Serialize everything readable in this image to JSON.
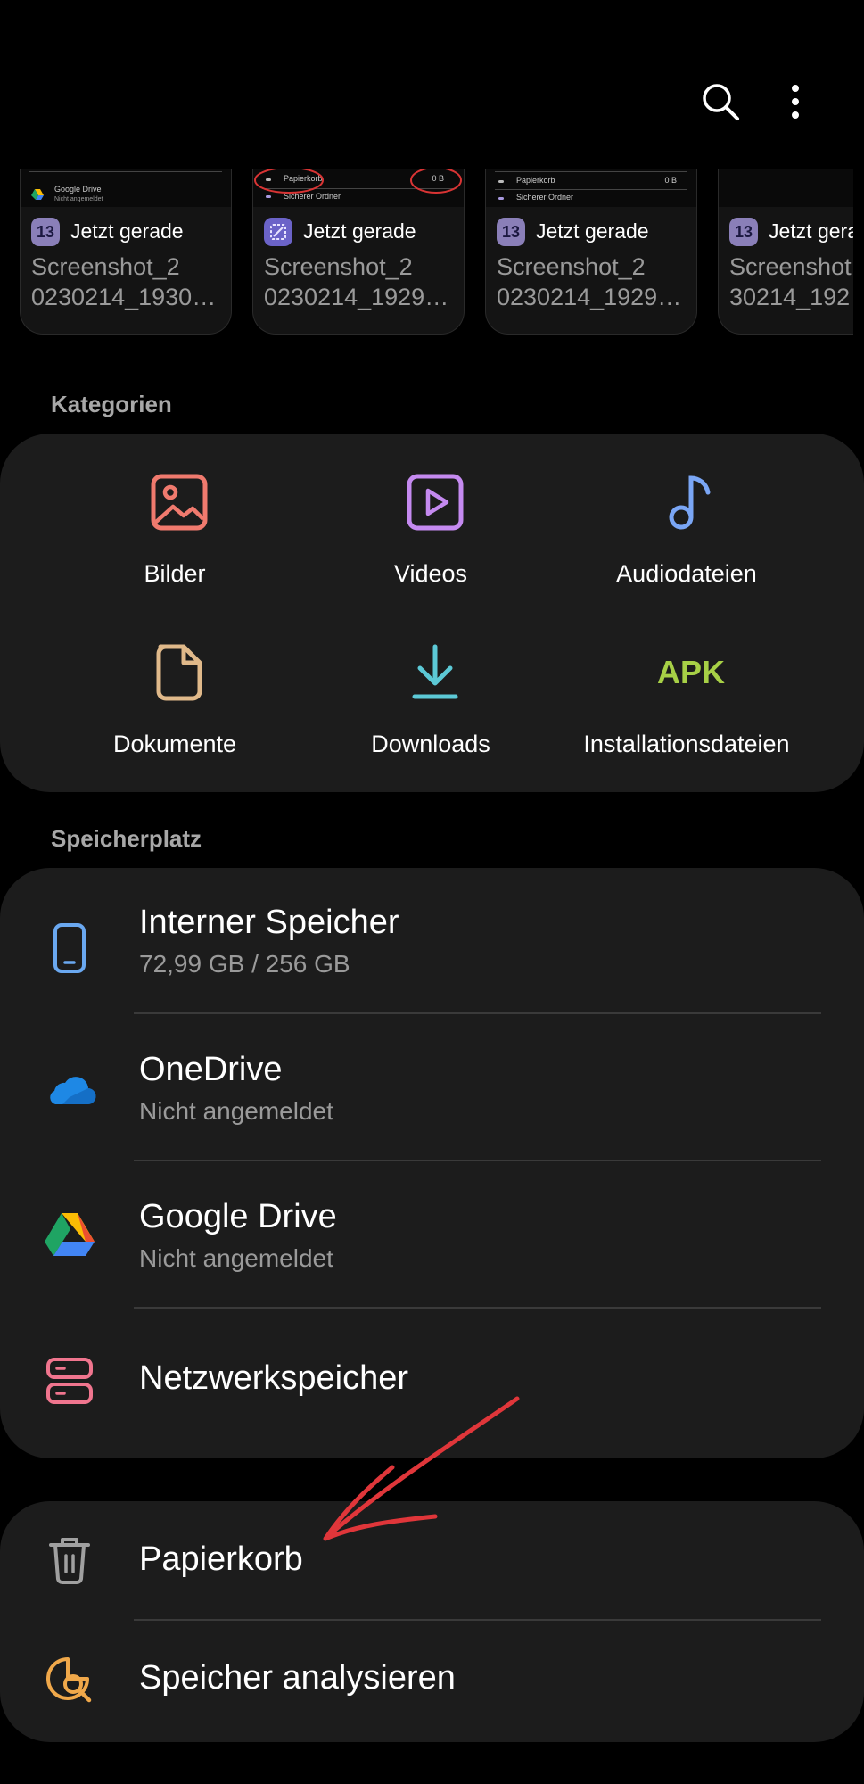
{
  "recents": [
    {
      "time": "Jetzt gerade",
      "name_line1": "Screenshot_2",
      "name_line2": "0230214_1930…",
      "icon": "13",
      "thumb": {
        "line1": "Google Drive",
        "line2": "Nicht angemeldet"
      }
    },
    {
      "time": "Jetzt gerade",
      "name_line1": "Screenshot_2",
      "name_line2": "0230214_1929…",
      "icon": "edit-icon",
      "thumb": {
        "line1": "Papierkorb",
        "size": "0 B",
        "line2": "Sicherer Ordner"
      }
    },
    {
      "time": "Jetzt gerade",
      "name_line1": "Screenshot_2",
      "name_line2": "0230214_1929…",
      "icon": "13",
      "thumb": {
        "line1": "Papierkorb",
        "size": "0 B",
        "line2": "Sicherer Ordner"
      }
    },
    {
      "time": "Jetzt gera",
      "name_line1": "Screenshot",
      "name_line2": "30214_192",
      "icon": "13",
      "thumb": {
        "line1": "",
        "line2": ""
      }
    }
  ],
  "categories_title": "Kategorien",
  "categories": [
    {
      "label": "Bilder",
      "icon": "image-icon",
      "color": "#f07a6e"
    },
    {
      "label": "Videos",
      "icon": "video-icon",
      "color": "#c58af0"
    },
    {
      "label": "Audiodateien",
      "icon": "music-icon",
      "color": "#7aa6f5"
    },
    {
      "label": "Dokumente",
      "icon": "document-icon",
      "color": "#e0b98a"
    },
    {
      "label": "Downloads",
      "icon": "download-icon",
      "color": "#5cc9d6"
    },
    {
      "label": "Installationsdateien",
      "icon": "apk-icon",
      "icon_text": "APK",
      "color": "#a7d046"
    }
  ],
  "storage_title": "Speicherplatz",
  "storage": [
    {
      "title": "Interner Speicher",
      "subtitle": "72,99 GB / 256 GB",
      "icon": "phone-icon",
      "color": "#6aa8f0"
    },
    {
      "title": "OneDrive",
      "subtitle": "Nicht angemeldet",
      "icon": "onedrive-icon",
      "color": "#1e88e5"
    },
    {
      "title": "Google Drive",
      "subtitle": "Nicht angemeldet",
      "icon": "google-drive-icon"
    },
    {
      "title": "Netzwerkspeicher",
      "subtitle": "",
      "icon": "server-icon",
      "color": "#f0758e"
    }
  ],
  "tools": [
    {
      "title": "Papierkorb",
      "icon": "trash-icon",
      "color": "#a0a0a0"
    },
    {
      "title": "Speicher analysieren",
      "icon": "analyze-icon",
      "color": "#f0a84a"
    }
  ],
  "annotation": {
    "color": "#e0363a"
  }
}
